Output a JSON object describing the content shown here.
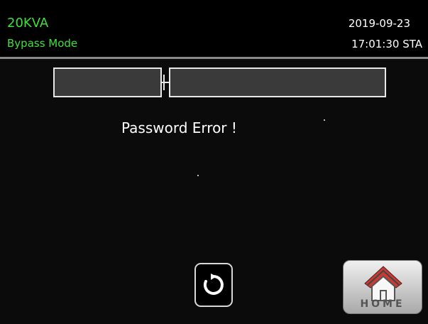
{
  "status": {
    "model": "20KVA",
    "mode": "Bypass Mode",
    "date": "2019-09-23",
    "time": "17:01:30 STA"
  },
  "message": "Password Error !",
  "buttons": {
    "refresh_icon": "refresh-icon",
    "home_label": "HOME"
  },
  "colors": {
    "status_green": "#3fe03a",
    "background": "#0b0b0b"
  }
}
